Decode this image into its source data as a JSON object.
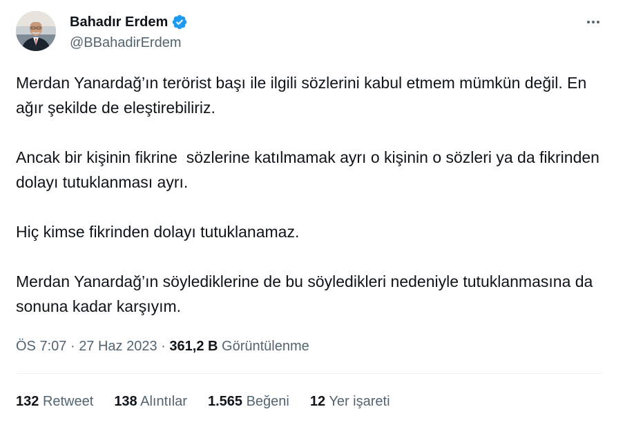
{
  "author": {
    "display_name": "Bahadır Erdem",
    "handle": "@BBahadirErdem",
    "verified": true,
    "verified_color": "#1d9bf0"
  },
  "menu": {
    "icon": "more-horizontal-icon"
  },
  "tweet": {
    "paragraphs": [
      "Merdan Yanardağ’ın terörist başı ile ilgili sözlerini kabul etmem mümkün değil. En ağır şekilde de eleştirebiliriz.",
      "Ancak bir kişinin fikrine  sözlerine katılmamak ayrı o kişinin o sözleri ya da fikrinden dolayı tutuklanması ayrı.",
      "Hiç kimse fikrinden dolayı tutuklanamaz.",
      "Merdan Yanardağ’ın söylediklerine de bu söyledikleri nedeniyle tutuklanmasına da sonuna kadar karşıyım."
    ]
  },
  "meta": {
    "time": "ÖS 7:07",
    "separator": "·",
    "date": "27 Haz 2023",
    "views_count": "361,2 B",
    "views_label": "Görüntülenme"
  },
  "stats": {
    "retweets": {
      "count": "132",
      "label": "Retweet"
    },
    "quotes": {
      "count": "138",
      "label": "Alıntılar"
    },
    "likes": {
      "count": "1.565",
      "label": "Beğeni"
    },
    "bookmarks": {
      "count": "12",
      "label": "Yer işareti"
    }
  }
}
